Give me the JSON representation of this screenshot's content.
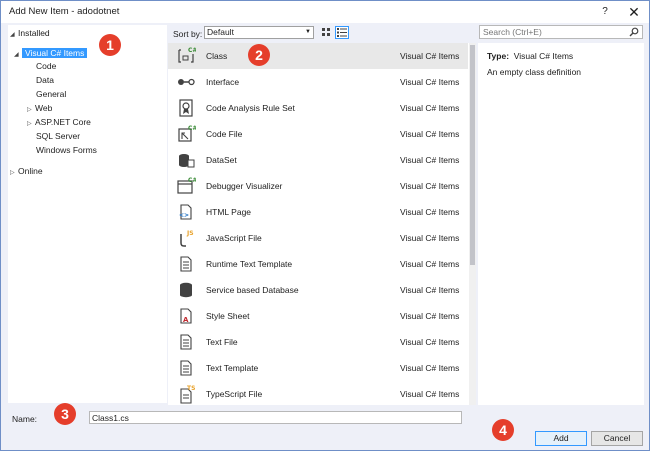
{
  "window": {
    "title": "Add New Item - adodotnet",
    "help_glyph": "?",
    "close_glyph": "✕"
  },
  "tree": {
    "installed_label": "Installed",
    "selected_label": "Visual C# Items",
    "children": [
      "Code",
      "Data",
      "General",
      "Web",
      "ASP.NET Core",
      "SQL Server",
      "Windows Forms"
    ],
    "online_label": "Online"
  },
  "toolbar": {
    "sort_label": "Sort by:",
    "sort_value": "Default",
    "search_placeholder": "Search (Ctrl+E)"
  },
  "templates": [
    {
      "name": "Class",
      "category": "Visual C# Items",
      "icon": "class-icon"
    },
    {
      "name": "Interface",
      "category": "Visual C# Items",
      "icon": "interface-icon"
    },
    {
      "name": "Code Analysis Rule Set",
      "category": "Visual C# Items",
      "icon": "rule-set-icon"
    },
    {
      "name": "Code File",
      "category": "Visual C# Items",
      "icon": "code-file-icon"
    },
    {
      "name": "DataSet",
      "category": "Visual C# Items",
      "icon": "dataset-icon"
    },
    {
      "name": "Debugger Visualizer",
      "category": "Visual C# Items",
      "icon": "visualizer-icon"
    },
    {
      "name": "HTML Page",
      "category": "Visual C# Items",
      "icon": "html-page-icon"
    },
    {
      "name": "JavaScript File",
      "category": "Visual C# Items",
      "icon": "javascript-file-icon"
    },
    {
      "name": "Runtime Text Template",
      "category": "Visual C# Items",
      "icon": "text-template-icon"
    },
    {
      "name": "Service based Database",
      "category": "Visual C# Items",
      "icon": "database-icon"
    },
    {
      "name": "Style Sheet",
      "category": "Visual C# Items",
      "icon": "style-sheet-icon"
    },
    {
      "name": "Text File",
      "category": "Visual C# Items",
      "icon": "text-file-icon"
    },
    {
      "name": "Text Template",
      "category": "Visual C# Items",
      "icon": "text-template-icon"
    },
    {
      "name": "TypeScript File",
      "category": "Visual C# Items",
      "icon": "typescript-file-icon"
    }
  ],
  "details": {
    "type_label": "Type:",
    "type_value": "Visual C# Items",
    "description": "An empty class definition"
  },
  "footer": {
    "name_label": "Name:",
    "name_value": "Class1.cs",
    "add_label": "Add",
    "cancel_label": "Cancel"
  },
  "callouts": [
    "1",
    "2",
    "3",
    "4"
  ],
  "colors": {
    "selection": "#3399ff",
    "callout": "#e53e2b",
    "csharp_green": "#388a34",
    "js_orange": "#e8a22b"
  }
}
